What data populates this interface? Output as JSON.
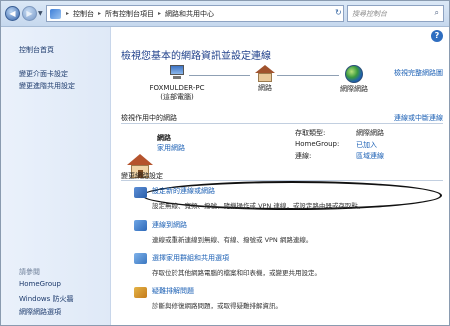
{
  "address": {
    "crumbs": [
      "控制台",
      "所有控制台項目",
      "網路和共用中心"
    ],
    "search_placeholder": "搜尋控制台"
  },
  "sidebar": {
    "home": "控制台首頁",
    "links": [
      "變更介面卡設定",
      "變更進階共用設定"
    ],
    "see_also_label": "請參閱",
    "see_also": [
      "HomeGroup",
      "Windows 防火牆",
      "網際網路選項"
    ]
  },
  "main": {
    "title": "檢視您基本的網路資訊並設定連線",
    "full_map_link": "檢視完整網路圖",
    "map": {
      "computer": [
        "FOXMULDER-PC",
        "(這部電腦)"
      ],
      "network": "網路",
      "internet": "網際網路"
    },
    "active_heading": "檢視作用中的網路",
    "connect_link": "連線或中斷連線",
    "network_name": "網路",
    "network_type": "家用網路",
    "access_type_label": "存取類型:",
    "access_type_value": "網際網路",
    "homegroup_label": "HomeGroup:",
    "homegroup_value": "已加入",
    "connections_label": "連線:",
    "connections_value": "區域連線",
    "change_heading": "變更網路設定",
    "tasks": [
      {
        "title": "設定新的連線或網路",
        "desc": "設定無線、寬頻、撥號、隨機操作或 VPN 連線，或設定路由器或存取點。"
      },
      {
        "title": "連線到網路",
        "desc": "連線或重新連線到無線、有線、撥號或 VPN 網路連線。"
      },
      {
        "title": "選擇家用群組和共用選項",
        "desc": "存取位於其他網路電腦的檔案和印表機，或變更共用設定。"
      },
      {
        "title": "疑難排解問題",
        "desc": "診斷與修復網路問題，或取得疑難排解資訊。"
      }
    ]
  }
}
